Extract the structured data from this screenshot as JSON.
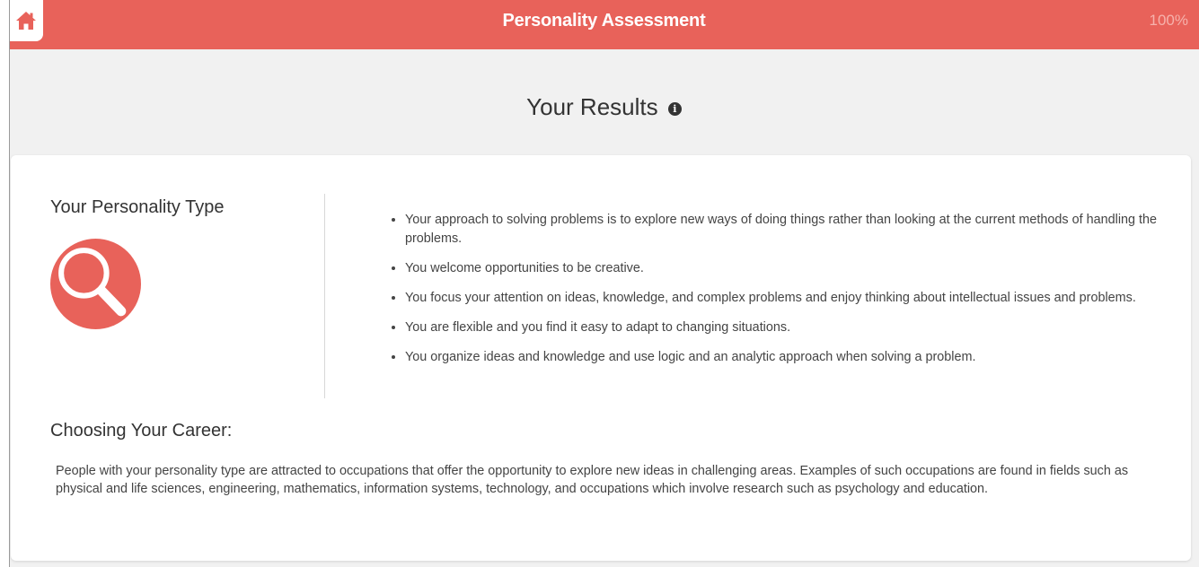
{
  "header": {
    "title": "Personality Assessment",
    "progress": "100%",
    "home_icon": "home-icon"
  },
  "results": {
    "title": "Your Results",
    "info_icon": "info-icon"
  },
  "personality": {
    "label": "Your Personality Type",
    "icon": "magnifier-icon",
    "traits": [
      "Your approach to solving problems is to explore new ways of doing things rather than looking at the current methods of handling the problems.",
      "You welcome opportunities to be creative.",
      "You focus your attention on ideas, knowledge, and complex problems and enjoy thinking about intellectual issues and problems.",
      "You are flexible and you find it easy to adapt to changing situations.",
      "You organize ideas and knowledge and use logic and an analytic approach when solving a problem."
    ]
  },
  "career": {
    "heading": "Choosing Your Career:",
    "text": "People with your personality type are attracted to occupations that offer the opportunity to explore new ideas in challenging areas. Examples of such occupations are found in fields such as physical and life sciences, engineering, mathematics, information systems, technology, and occupations which involve research such as psychology and education."
  },
  "colors": {
    "brand": "#e8625a",
    "background": "#f1f1f1",
    "card": "#ffffff",
    "text": "#333333"
  }
}
